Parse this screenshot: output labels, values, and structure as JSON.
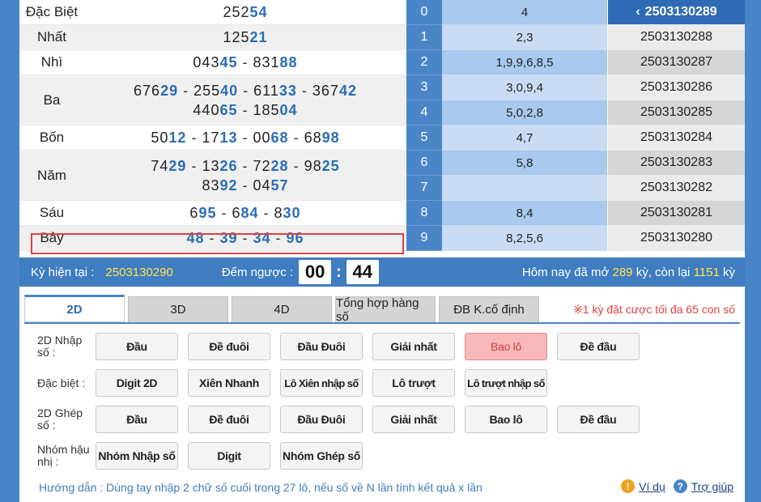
{
  "results": [
    {
      "name": "Đặc Biệt",
      "lines": [
        [
          [
            "252",
            "54"
          ]
        ]
      ]
    },
    {
      "name": "Nhất",
      "lines": [
        [
          [
            "125",
            "21"
          ]
        ]
      ]
    },
    {
      "name": "Nhì",
      "lines": [
        [
          [
            "043",
            "45"
          ],
          [
            "831",
            "88"
          ]
        ]
      ]
    },
    {
      "name": "Ba",
      "lines": [
        [
          [
            "676",
            "29"
          ],
          [
            "255",
            "40"
          ],
          [
            "611",
            "33"
          ],
          [
            "367",
            "42"
          ]
        ],
        [
          [
            "440",
            "65"
          ],
          [
            "185",
            "04"
          ]
        ]
      ]
    },
    {
      "name": "Bốn",
      "lines": [
        [
          [
            "50",
            "12"
          ],
          [
            "17",
            "13"
          ],
          [
            "00",
            "68"
          ],
          [
            "68",
            "98"
          ]
        ]
      ]
    },
    {
      "name": "Năm",
      "lines": [
        [
          [
            "74",
            "29"
          ],
          [
            "13",
            "26"
          ],
          [
            "72",
            "28"
          ],
          [
            "98",
            "25"
          ]
        ],
        [
          [
            "83",
            "92"
          ],
          [
            "04",
            "57"
          ]
        ]
      ]
    },
    {
      "name": "Sáu",
      "lines": [
        [
          [
            "6",
            "95"
          ],
          [
            "6",
            "84"
          ],
          [
            "8",
            "30"
          ]
        ]
      ]
    },
    {
      "name": "Bảy",
      "lines": [
        [
          [
            "",
            "48"
          ],
          [
            "",
            "39"
          ],
          [
            "",
            "34"
          ],
          [
            "",
            "96"
          ]
        ]
      ]
    }
  ],
  "lo": [
    {
      "num": "0",
      "val": "4",
      "id": "2503130289"
    },
    {
      "num": "1",
      "val": "2,3",
      "id": "2503130288"
    },
    {
      "num": "2",
      "val": "1,9,9,6,8,5",
      "id": "2503130287"
    },
    {
      "num": "3",
      "val": "3,0,9,4",
      "id": "2503130286"
    },
    {
      "num": "4",
      "val": "5,0,2,8",
      "id": "2503130285"
    },
    {
      "num": "5",
      "val": "4,7",
      "id": "2503130284"
    },
    {
      "num": "6",
      "val": "5,8",
      "id": "2503130283"
    },
    {
      "num": "7",
      "val": "",
      "id": "2503130282"
    },
    {
      "num": "8",
      "val": "8,4",
      "id": "2503130281"
    },
    {
      "num": "9",
      "val": "8,2,5,6",
      "id": "2503130280"
    }
  ],
  "status": {
    "ky_label": "Kỳ hiện tại  :",
    "ky_value": "2503130290",
    "countdown_label": "Đếm ngược :",
    "minutes": "00",
    "seconds": "44",
    "today_prefix": "Hôm nay đã mở ",
    "opened": "289",
    "today_mid": " kỳ, còn lại ",
    "remaining": "1151",
    "today_suffix": " kỳ"
  },
  "tabs": [
    "2D",
    "3D",
    "4D",
    "Tổng hợp hàng số",
    "ĐB K.cố định"
  ],
  "tab_note": "※1 kỳ đặt cược tối đa 65 con số",
  "groups": [
    {
      "label": "2D Nhập số :",
      "buttons": [
        "Đầu",
        "Đề đuôi",
        "Đầu Đuôi",
        "Giải nhất",
        "Bao lô",
        "Đề đầu"
      ]
    },
    {
      "label": "Đặc biệt :",
      "buttons": [
        "Digit 2D",
        "Xiên Nhanh",
        "Lô Xiên nhập số",
        "Lô trượt",
        "Lô trượt nhập số"
      ]
    },
    {
      "label": "2D Ghép số :",
      "buttons": [
        "Đầu",
        "Đề đuôi",
        "Đầu Đuôi",
        "Giải nhất",
        "Bao lô",
        "Đề đầu"
      ]
    },
    {
      "label": "Nhóm hậu nhị :",
      "buttons": [
        "Nhóm Nhập số",
        "Digit",
        "Nhóm Ghép số"
      ]
    }
  ],
  "guide": "Hướng dẫn : Dùng tay nhập 2 chữ số cuối trong 27 lô, nếu số về N lần tính kết quả x lần",
  "help": {
    "example": "Ví dụ",
    "support": "Trợ giúp"
  },
  "colors": {
    "accent": "#4a86c7",
    "highlight": "#ffe34d",
    "selected": "#f7b9b9",
    "alert": "#e04040"
  }
}
